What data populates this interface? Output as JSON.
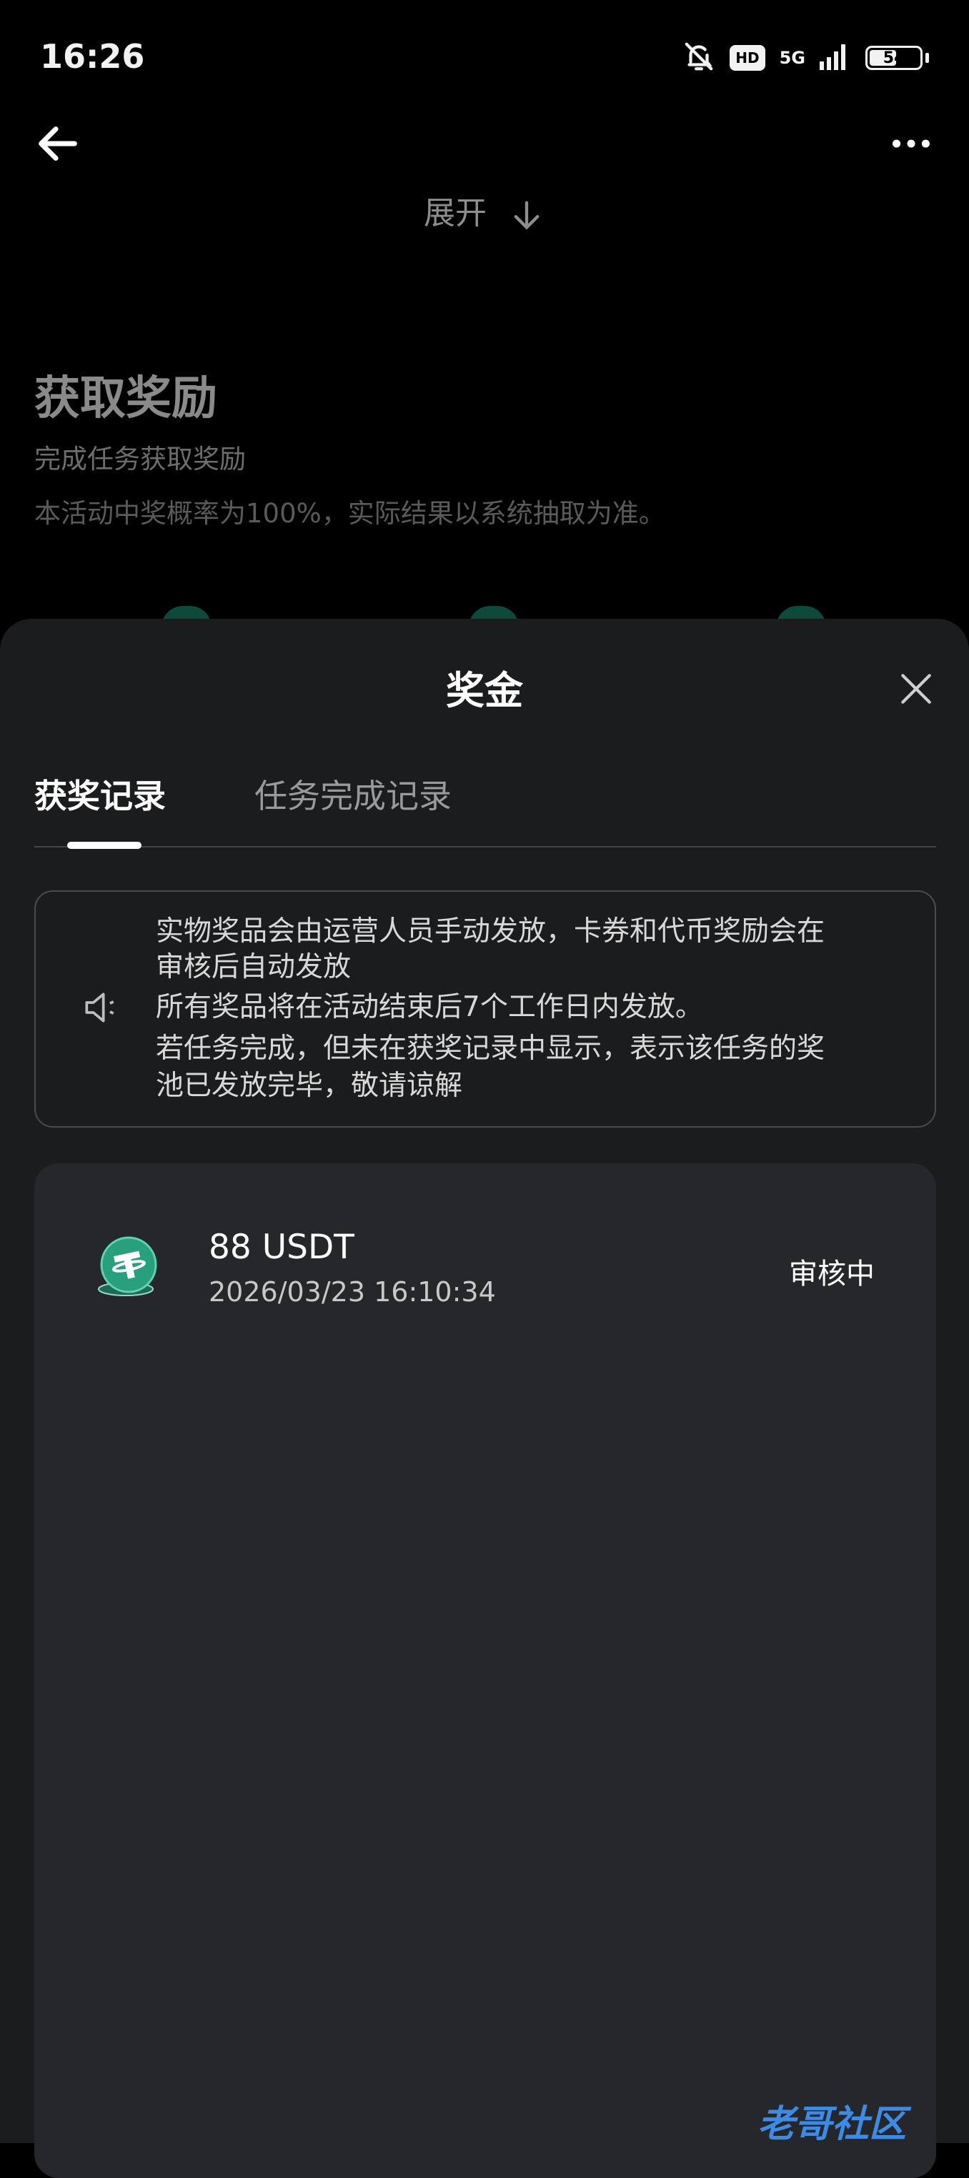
{
  "status_bar": {
    "time": "16:26",
    "hd_label": "HD",
    "network_label": "5G",
    "battery_level": "54"
  },
  "background_page": {
    "expand_label": "展开",
    "heading": "获取奖励",
    "subheading": "完成任务获取奖励",
    "note": "本活动中奖概率为100%，实际结果以系统抽取为准。"
  },
  "sheet": {
    "title": "奖金",
    "tabs": [
      {
        "label": "获奖记录",
        "active": true
      },
      {
        "label": "任务完成记录",
        "active": false
      }
    ],
    "notice": {
      "lines": [
        "实物奖品会由运营人员手动发放，卡券和代币奖励会在",
        "审核后自动发放",
        "所有奖品将在活动结束后7个工作日内发放。",
        "若任务完成，但未在获奖记录中显示，表示该任务的奖",
        "池已发放完毕，敬请谅解"
      ]
    },
    "records": [
      {
        "amount": "88 USDT",
        "time": "2026/03/23 16:10:34",
        "status": "审核中"
      }
    ]
  },
  "watermark": "老哥社区",
  "colors": {
    "sheet_bg": "#1b1c1e",
    "card_bg": "#25272a",
    "usdt_green": "#26a17b"
  }
}
